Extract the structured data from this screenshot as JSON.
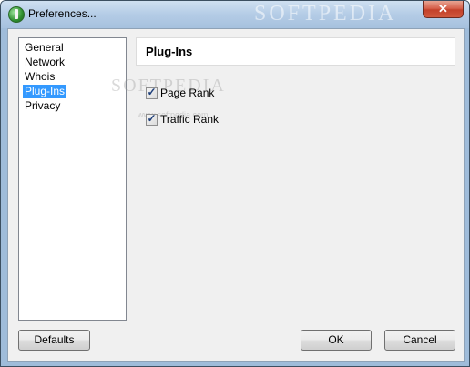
{
  "window": {
    "title": "Preferences...",
    "watermark": "SOFTPEDIA",
    "close_glyph": "✕"
  },
  "nav": {
    "items": [
      {
        "label": "General",
        "selected": false
      },
      {
        "label": "Network",
        "selected": false
      },
      {
        "label": "Whois",
        "selected": false
      },
      {
        "label": "Plug-Ins",
        "selected": true
      },
      {
        "label": "Privacy",
        "selected": false
      }
    ]
  },
  "panel": {
    "title": "Plug-Ins",
    "options": [
      {
        "label": "Page Rank",
        "checked": true
      },
      {
        "label": "Traffic Rank",
        "checked": true
      }
    ],
    "watermark": "SOFTPEDIA",
    "watermark_url": "www.softpedia.com"
  },
  "buttons": {
    "defaults": "Defaults",
    "ok": "OK",
    "cancel": "Cancel"
  },
  "icons": {
    "app": "app-globe-icon",
    "close": "close-icon",
    "check": "checkmark-icon"
  }
}
